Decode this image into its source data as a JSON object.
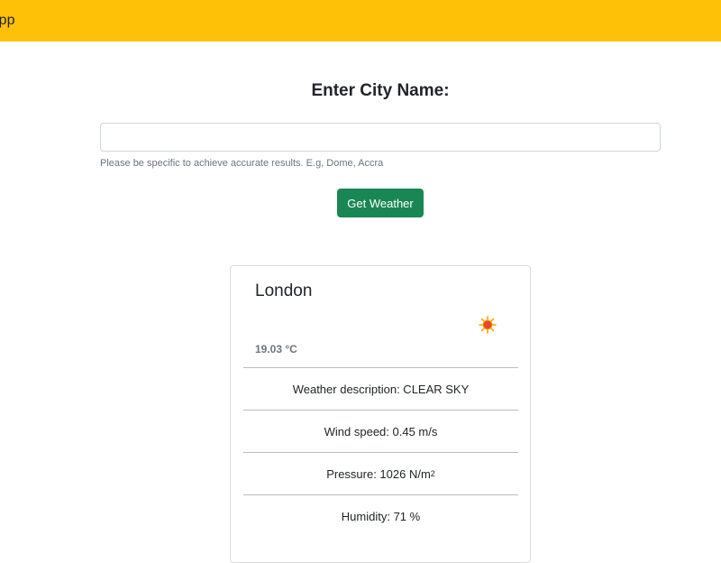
{
  "navbar": {
    "brand": "App",
    "color": "#ffc107"
  },
  "form": {
    "title": "Enter City Name:",
    "city_input_value": "",
    "city_input_placeholder": "",
    "help_text": "Please be specific to achieve accurate results. E.g, Dome, Accra",
    "button_label": "Get Weather",
    "button_color": "#198754"
  },
  "weather_card": {
    "city": "London",
    "icon": "sun-icon",
    "temperature": "19.03 °C",
    "description": "Weather description: CLEAR SKY",
    "wind_speed": "Wind speed: 0.45 m/s",
    "pressure": "Pressure: 1026 N/m",
    "pressure_unit_exponent": "2",
    "humidity": "Humidity: 71 %"
  }
}
